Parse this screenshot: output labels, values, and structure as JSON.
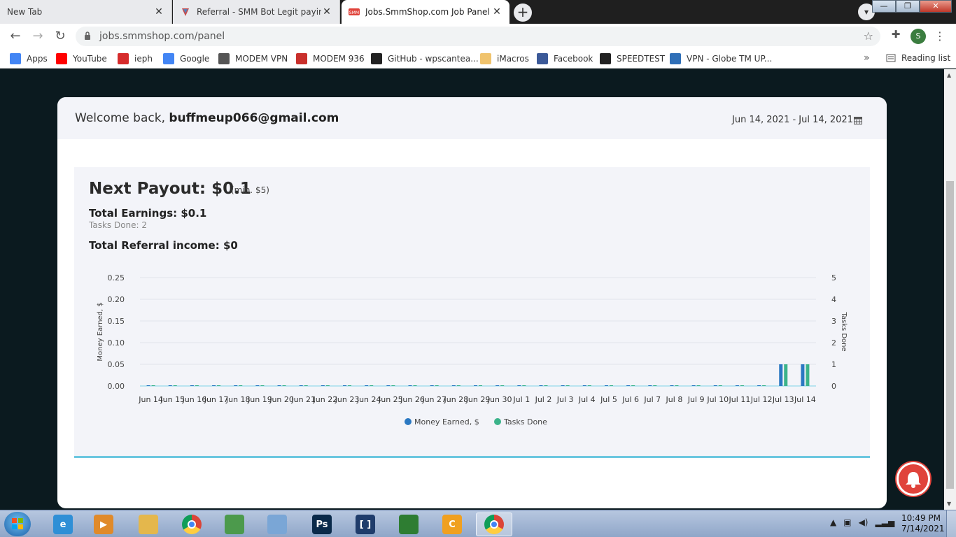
{
  "browser": {
    "tabs": [
      {
        "title": "New Tab",
        "active": false
      },
      {
        "title": "Referral - SMM Bot Legit paying!",
        "active": false
      },
      {
        "title": "Jobs.SmmShop.com Job Panel",
        "active": true
      }
    ],
    "new_tab_label": "+",
    "url": "jobs.smmshop.com/panel",
    "profile_initial": "S",
    "window_controls": {
      "minimize": "—",
      "maximize": "❐",
      "close": "✕"
    }
  },
  "bookmarks": {
    "items": [
      {
        "label": "Apps",
        "icon": "apps-grid-icon",
        "color": "#4285f4"
      },
      {
        "label": "YouTube",
        "icon": "youtube-icon",
        "color": "#ff0000"
      },
      {
        "label": "ieph",
        "icon": "ieph-icon",
        "color": "#d62b2b"
      },
      {
        "label": "Google",
        "icon": "google-icon",
        "color": "#4285f4"
      },
      {
        "label": "MODEM VPN",
        "icon": "globe-icon",
        "color": "#555555"
      },
      {
        "label": "MODEM 936",
        "icon": "huawei-icon",
        "color": "#c9302c"
      },
      {
        "label": "GitHub - wpscantea...",
        "icon": "github-icon",
        "color": "#222222"
      },
      {
        "label": "iMacros",
        "icon": "folder-icon",
        "color": "#f0c36d"
      },
      {
        "label": "Facebook",
        "icon": "facebook-icon",
        "color": "#3b5998"
      },
      {
        "label": "SPEEDTEST",
        "icon": "speedometer-icon",
        "color": "#222222"
      },
      {
        "label": "VPN - Globe TM UP...",
        "icon": "vpn-icon",
        "color": "#2f6fb7"
      }
    ],
    "more_label": "»",
    "reading_list_label": "Reading list"
  },
  "page": {
    "welcome_prefix": "Welcome back, ",
    "user_email": "buffmeup066@gmail.com",
    "date_range": "Jun 14, 2021 - Jul 14, 2021",
    "next_payout_label": "Next Payout: $0.1",
    "payout_min": "(min. $5)",
    "total_earnings": "Total Earnings: $0.1",
    "tasks_done": "Tasks Done: 2",
    "total_referral": "Total Referral income: $0"
  },
  "chart_data": {
    "type": "bar",
    "categories": [
      "Jun 14",
      "Jun 15",
      "Jun 16",
      "Jun 17",
      "Jun 18",
      "Jun 19",
      "Jun 20",
      "Jun 21",
      "Jun 22",
      "Jun 23",
      "Jun 24",
      "Jun 25",
      "Jun 26",
      "Jun 27",
      "Jun 28",
      "Jun 29",
      "Jun 30",
      "Jul 1",
      "Jul 2",
      "Jul 3",
      "Jul 4",
      "Jul 5",
      "Jul 6",
      "Jul 7",
      "Jul 8",
      "Jul 9",
      "Jul 10",
      "Jul 11",
      "Jul 12",
      "Jul 13",
      "Jul 14"
    ],
    "series": [
      {
        "name": "Money Earned, $",
        "color": "#2a78c2",
        "axis": "left",
        "values": [
          0,
          0,
          0,
          0,
          0,
          0,
          0,
          0,
          0,
          0,
          0,
          0,
          0,
          0,
          0,
          0,
          0,
          0,
          0,
          0,
          0,
          0,
          0,
          0,
          0,
          0,
          0,
          0,
          0,
          0.05,
          0.05
        ]
      },
      {
        "name": "Tasks Done",
        "color": "#3bb38a",
        "axis": "right",
        "values": [
          0,
          0,
          0,
          0,
          0,
          0,
          0,
          0,
          0,
          0,
          0,
          0,
          0,
          0,
          0,
          0,
          0,
          0,
          0,
          0,
          0,
          0,
          0,
          0,
          0,
          0,
          0,
          0,
          0,
          1,
          1
        ]
      }
    ],
    "ylabel": "Money Earned, $",
    "y2label": "Tasks Done",
    "ylim": [
      0,
      0.25
    ],
    "y2lim": [
      0,
      5
    ],
    "yticks": [
      "0.00",
      "0.05",
      "0.10",
      "0.15",
      "0.20",
      "0.25"
    ],
    "y2ticks": [
      "0",
      "1",
      "2",
      "3",
      "4",
      "5"
    ],
    "grid": true,
    "legend_position": "bottom"
  },
  "taskbar": {
    "apps": [
      {
        "name": "internet-explorer",
        "icon": "ie-icon",
        "color": "#2f8fd6",
        "glyph": "e"
      },
      {
        "name": "media-player",
        "icon": "media-player-icon",
        "color": "#e08a2a",
        "glyph": "▶"
      },
      {
        "name": "file-explorer",
        "icon": "folder-icon",
        "color": "#e4b74c",
        "glyph": ""
      },
      {
        "name": "chrome",
        "icon": "chrome-icon",
        "color": "#db4437",
        "glyph": ""
      },
      {
        "name": "notepad",
        "icon": "notepad-icon",
        "color": "#4c9a4c",
        "glyph": ""
      },
      {
        "name": "paint",
        "icon": "paint-icon",
        "color": "#7aa6d6",
        "glyph": ""
      },
      {
        "name": "photoshop",
        "icon": "photoshop-icon",
        "color": "#0a2a4a",
        "glyph": "Ps"
      },
      {
        "name": "bracket-app",
        "icon": "bracket-icon",
        "color": "#1f3c6b",
        "glyph": "[ ]"
      },
      {
        "name": "security-app",
        "icon": "shield-icon",
        "color": "#2e7d32",
        "glyph": ""
      },
      {
        "name": "c-app",
        "icon": "c-coin-icon",
        "color": "#f0a020",
        "glyph": "C"
      },
      {
        "name": "chrome-active",
        "icon": "chrome-icon",
        "color": "#db4437",
        "glyph": ""
      }
    ],
    "time": "10:49 PM",
    "date": "7/14/2021"
  }
}
